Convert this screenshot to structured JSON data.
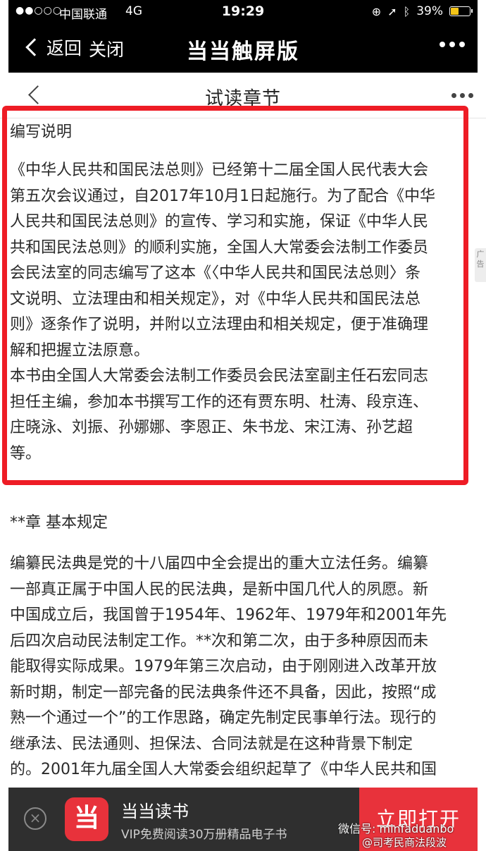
{
  "status_bar": {
    "signal": "●●○○○",
    "carrier": "中国联通",
    "network": "4G",
    "time": "19:29",
    "battery": "39%",
    "battery_level": 0.39
  },
  "nav_bar": {
    "back_label": "返回",
    "close_label": "关闭",
    "title": "当当触屏版"
  },
  "page_header": {
    "title": "试读章节"
  },
  "content": {
    "heading": "编写说明",
    "intro_lines": [
      "《中华人民共和国民法总则》已经第十二届全国人民代表大会",
      "第五次会议通过，自2017年10月1日起施行。为了配合《中华",
      "人民共和国民法总则》的宣传、学习和实施，保证《中华人民",
      "共和国民法总则》的顺利实施，全国人大常委会法制工作委员",
      "会民法室的同志编写了这本《〈中华人民共和国民法总则〉条",
      "文说明、立法理由和相关规定》，对《中华人民共和国民法总",
      "则》逐条作了说明，并附以立法理由和相关规定，便于准确理",
      "解和把握立法原意。",
      "本书由全国人大常委会法制工作委员会民法室副主任石宏同志",
      "担任主编，参加本书撰写工作的还有贾东明、杜涛、段京连、",
      "庄晓泳、刘振、孙娜娜、李恩正、朱书龙、宋江涛、孙艺超",
      "等。"
    ],
    "chapter_title": "**章 基本规定",
    "body_lines": [
      "编纂民法典是党的十八届四中全会提出的重大立法任务。编纂",
      "一部真正属于中国人民的民法典，是新中国几代人的夙愿。新",
      "中国成立后，我国曾于1954年、1962年、1979年和2001年先",
      "后四次启动民法制定工作。**次和第二次，由于多种原因而未",
      "能取得实际成果。1979年第三次启动，由于刚刚进入改革开放",
      "新时期，制定一部完备的民法典条件还不具备，因此，按照“成",
      "熟一个通过一个”的工作思路，确定先制定民事单行法。现行的",
      "继承法、民法通则、担保法、合同法就是在这种背景下制定",
      "的。2001年九届全国人大常委会组织起草了《中华人民共和国"
    ]
  },
  "side_tag": {
    "label": "广告"
  },
  "banner": {
    "app_name": "当当读书",
    "subtitle": "VIP免费阅读30万册精品电子书",
    "open_label": "立即打开",
    "close_symbol": "×",
    "logo_glyph": "当"
  },
  "watermark": {
    "line1": "微信号: minfaduanbo",
    "line2": "@司考民商法段波"
  },
  "colors": {
    "highlight": "#ee1c25",
    "accent": "#e8323b",
    "battery": "#f5c518"
  }
}
